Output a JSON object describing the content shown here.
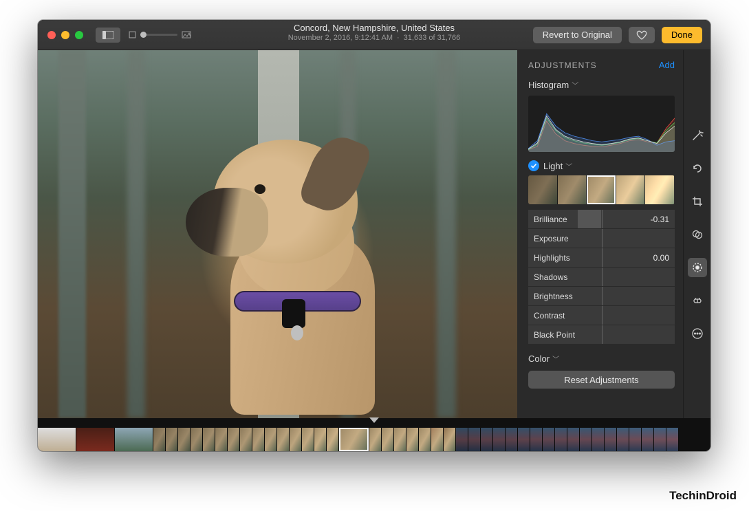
{
  "titlebar": {
    "location": "Concord, New Hampshire, United States",
    "datetime": "November 2, 2016, 9:12:41 AM",
    "counter": "31,633 of 31,766",
    "revert": "Revert to Original",
    "done": "Done"
  },
  "adjust": {
    "header": "ADJUSTMENTS",
    "add": "Add",
    "histogram_label": "Histogram",
    "light_label": "Light",
    "color_label": "Color",
    "reset": "Reset Adjustments",
    "sliders": [
      {
        "label": "Brilliance",
        "value": "-0.31",
        "fillLeft": 34,
        "fillWidth": 16
      },
      {
        "label": "Exposure",
        "value": "",
        "fillLeft": 50,
        "fillWidth": 0
      },
      {
        "label": "Highlights",
        "value": "0.00",
        "fillLeft": 50,
        "fillWidth": 0
      },
      {
        "label": "Shadows",
        "value": "",
        "fillLeft": 50,
        "fillWidth": 0
      },
      {
        "label": "Brightness",
        "value": "",
        "fillLeft": 50,
        "fillWidth": 0
      },
      {
        "label": "Contrast",
        "value": "",
        "fillLeft": 50,
        "fillWidth": 0
      },
      {
        "label": "Black Point",
        "value": "",
        "fillLeft": 50,
        "fillWidth": 0
      }
    ]
  },
  "tools": [
    {
      "name": "magic-wand-icon",
      "active": false
    },
    {
      "name": "rotate-icon",
      "active": false
    },
    {
      "name": "crop-icon",
      "active": false
    },
    {
      "name": "filters-icon",
      "active": false
    },
    {
      "name": "adjust-icon",
      "active": true
    },
    {
      "name": "retouch-icon",
      "active": false
    },
    {
      "name": "more-icon",
      "active": false
    }
  ],
  "chart_data": {
    "type": "area",
    "title": "Histogram",
    "xlabel": "",
    "ylabel": "",
    "xlim": [
      0,
      255
    ],
    "ylim": [
      0,
      100
    ],
    "x": [
      0,
      16,
      32,
      48,
      64,
      80,
      96,
      112,
      128,
      144,
      160,
      176,
      192,
      208,
      224,
      240,
      255
    ],
    "series": [
      {
        "name": "Red",
        "color": "#e04a3f",
        "values": [
          4,
          10,
          55,
          32,
          20,
          15,
          12,
          10,
          9,
          12,
          15,
          20,
          22,
          18,
          16,
          42,
          60
        ]
      },
      {
        "name": "Green",
        "color": "#58c05a",
        "values": [
          4,
          14,
          60,
          38,
          26,
          20,
          16,
          14,
          12,
          14,
          17,
          22,
          24,
          20,
          16,
          38,
          52
        ]
      },
      {
        "name": "Blue",
        "color": "#4b86e0",
        "values": [
          6,
          20,
          68,
          46,
          34,
          28,
          24,
          20,
          18,
          20,
          22,
          26,
          28,
          22,
          12,
          18,
          20
        ]
      },
      {
        "name": "Luminance",
        "color": "#d8d8d8",
        "values": [
          5,
          16,
          64,
          40,
          28,
          22,
          18,
          15,
          13,
          15,
          18,
          23,
          25,
          20,
          15,
          34,
          46
        ]
      }
    ]
  },
  "watermark": "TechinDroid"
}
